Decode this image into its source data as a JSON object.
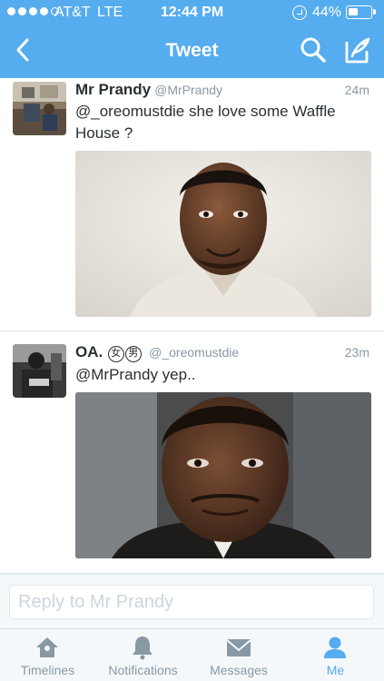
{
  "status_bar": {
    "carrier": "AT&T",
    "network": "LTE",
    "time": "12:44 PM",
    "battery": "44%",
    "battery_level": 0.44
  },
  "nav": {
    "title": "Tweet",
    "back_icon": "chevron-left-icon",
    "search_icon": "search-icon",
    "compose_icon": "compose-icon"
  },
  "tweets": [
    {
      "name": "Mr Prandy",
      "handle": "@MrPrandy",
      "time": "24m",
      "text": "@_oreomustdie she love some Waffle House ?"
    },
    {
      "name": "OA.",
      "badges": [
        "女",
        "男"
      ],
      "handle": "@_oreomustdie",
      "time": "23m",
      "text": "@MrPrandy yep.."
    }
  ],
  "reply": {
    "placeholder": "Reply to Mr Prandy"
  },
  "tabbar": {
    "tabs": [
      {
        "label": "Timelines",
        "icon": "home-icon"
      },
      {
        "label": "Notifications",
        "icon": "bell-icon"
      },
      {
        "label": "Messages",
        "icon": "envelope-icon"
      },
      {
        "label": "Me",
        "icon": "person-icon"
      }
    ],
    "active": "Me"
  },
  "colors": {
    "brand": "#55acee",
    "text": "#292f33",
    "muted": "#8899a6"
  }
}
